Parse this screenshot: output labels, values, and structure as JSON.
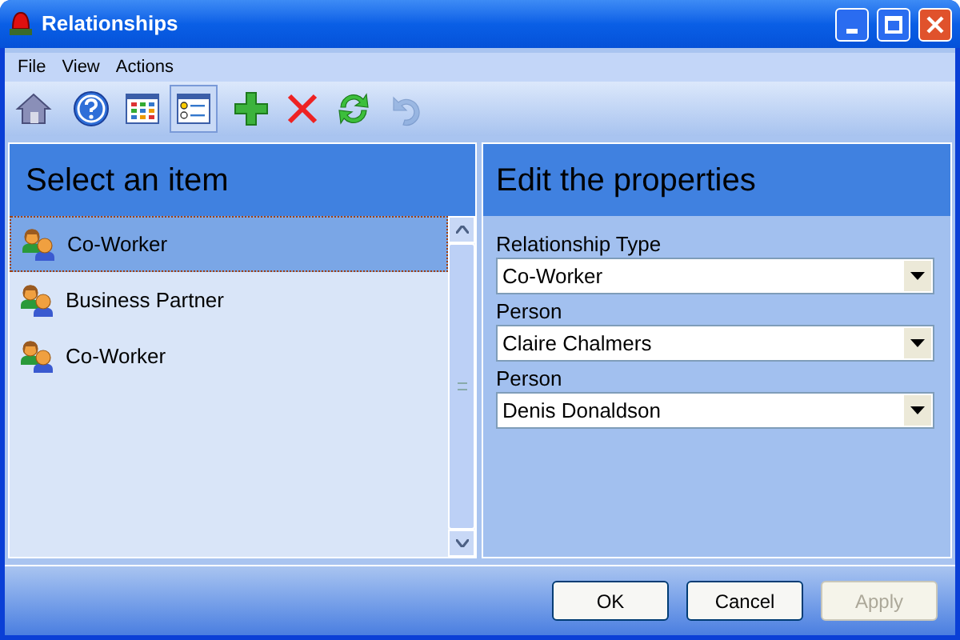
{
  "window": {
    "title": "Relationships"
  },
  "menu": [
    "File",
    "View",
    "Actions"
  ],
  "toolbar": [
    {
      "kind": "home",
      "selected": false,
      "disabled": false
    },
    {
      "kind": "help",
      "selected": false,
      "disabled": false
    },
    {
      "kind": "grid",
      "selected": false,
      "disabled": false
    },
    {
      "kind": "form",
      "selected": true,
      "disabled": false
    },
    {
      "kind": "add",
      "selected": false,
      "disabled": false
    },
    {
      "kind": "delete",
      "selected": false,
      "disabled": false
    },
    {
      "kind": "refresh",
      "selected": false,
      "disabled": false
    },
    {
      "kind": "undo",
      "selected": false,
      "disabled": true
    }
  ],
  "list": {
    "title": "Select an item",
    "items": [
      {
        "label": "Co-Worker",
        "selected": true
      },
      {
        "label": "Business Partner",
        "selected": false
      },
      {
        "label": "Co-Worker",
        "selected": false
      }
    ]
  },
  "properties": {
    "title": "Edit the properties",
    "fields": [
      {
        "label": "Relationship Type",
        "value": "Co-Worker"
      },
      {
        "label": "Person",
        "value": "Claire Chalmers"
      },
      {
        "label": "Person",
        "value": "Denis Donaldson"
      }
    ]
  },
  "buttons": [
    {
      "label": "OK",
      "disabled": false
    },
    {
      "label": "Cancel",
      "disabled": false
    },
    {
      "label": "Apply",
      "disabled": true
    }
  ]
}
